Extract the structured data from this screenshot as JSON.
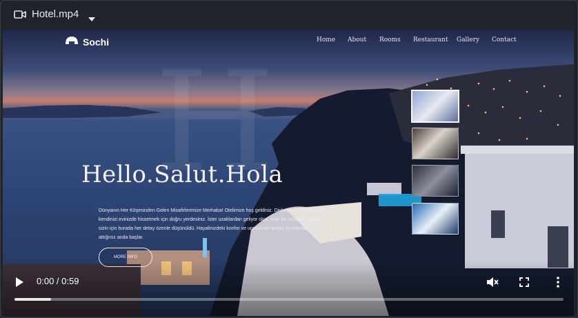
{
  "file": {
    "name": "Hotel.mp4",
    "camera_icon": "video-camera-icon",
    "dropdown_icon": "chevron-down-icon"
  },
  "website": {
    "logo_text": "Sochi",
    "logo_icon": "sunrise-icon",
    "nav_links": [
      "Home",
      "About",
      "Rooms",
      "Restaurant",
      "Gallery",
      "Contact"
    ],
    "background_letter": "H",
    "hero_title": "Hello.Salut.Hola",
    "hero_description": "Dünyanın Her Köşesinden Gelen Misafirlerimize Merhaba! Otelimize hoş geldiniz. Dinlenmek, keşfetmek ve kendinizi evinizde hissetmek için doğru yerdesiniz. İster uzaklardan geliyor olun, ister bir kaçamak yapıyor olun, sizin için burada her detay özenle düşünüldü. Hayalinizdeki konfor ve unutulmaz anılar, bu kapıdan içeri adım attığınız anda başlar.",
    "more_button": "MORE INFO",
    "gallery_thumbs": [
      "thumb-terrace",
      "thumb-restaurant",
      "thumb-room",
      "thumb-coast"
    ]
  },
  "player": {
    "time_display": "0:00 / 0:59",
    "progress": 0.066,
    "play_icon": "play-icon",
    "mute_icon": "volume-muted-icon",
    "fullscreen_icon": "fullscreen-icon",
    "menu_icon": "more-vertical-icon"
  },
  "colors": {
    "accent": "#e8eaed",
    "background": "#20242b"
  }
}
